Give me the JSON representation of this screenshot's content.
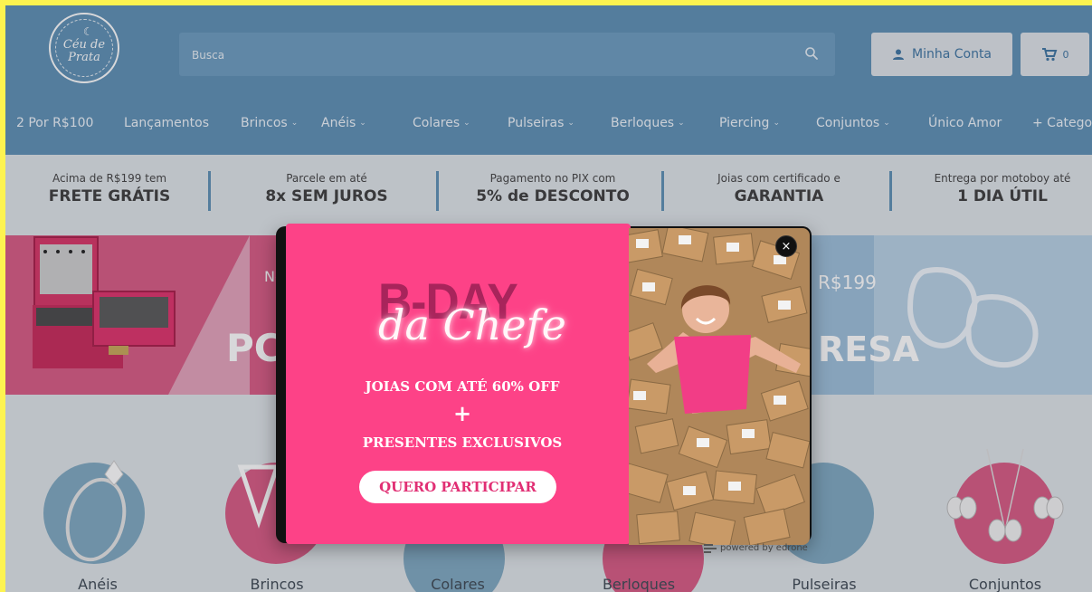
{
  "header": {
    "logo_text": "Céu de Prata",
    "search_placeholder": "Busca",
    "account_label": "Minha Conta",
    "cart_count": "0"
  },
  "nav": {
    "items": [
      {
        "label": "2 Por R$100"
      },
      {
        "label": "Lançamentos"
      },
      {
        "label": "Brincos"
      },
      {
        "label": "Anéis"
      },
      {
        "label": "Colares"
      },
      {
        "label": "Pulseiras"
      },
      {
        "label": "Berloques"
      },
      {
        "label": "Piercing"
      },
      {
        "label": "Conjuntos"
      },
      {
        "label": "Único Amor"
      },
      {
        "label": "+ Categor"
      }
    ]
  },
  "benefits": [
    {
      "small": "Acima de R$199 tem",
      "big": "FRETE GRÁTIS"
    },
    {
      "small": "Parcele em até",
      "big": "8x SEM JUROS"
    },
    {
      "small": "Pagamento no PIX com",
      "big": "5% de DESCONTO"
    },
    {
      "small": "Joias com certificado e",
      "big": "GARANTIA"
    },
    {
      "small": "Entrega por motoboy até",
      "big": "1 DIA ÚTIL"
    }
  ],
  "banner": {
    "left_small": "No",
    "left_big": "PC",
    "right_small": "R$199",
    "right_big": "RESA"
  },
  "popup": {
    "headline_top": "B-DAY",
    "headline_script": "da Chefe",
    "line1": "JOIAS COM ATÉ 60% OFF",
    "plus": "+",
    "line2": "PRESENTES EXCLUSIVOS",
    "cta": "QUERO PARTICIPAR",
    "close": "×",
    "powered": "powered by edrone"
  },
  "categories": [
    {
      "label": "Anéis"
    },
    {
      "label": "Brincos"
    },
    {
      "label": "Colares"
    },
    {
      "label": "Berloques"
    },
    {
      "label": "Pulseiras"
    },
    {
      "label": "Conjuntos"
    }
  ],
  "colors": {
    "header": "#5e90b5",
    "popup_pink": "#fd4287",
    "cta_text": "#e12f74"
  }
}
